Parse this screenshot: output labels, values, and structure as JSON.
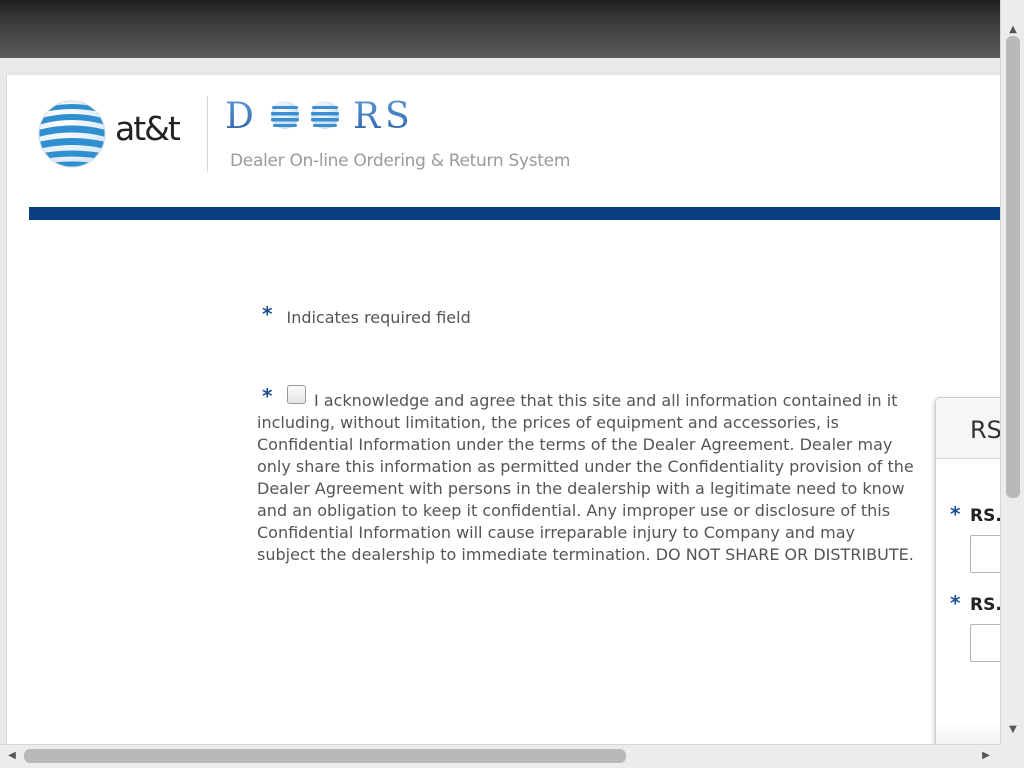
{
  "header": {
    "brand_wordmark": "at&t",
    "app_logo_text": "DOORS",
    "app_subtitle": "Dealer On-line Ordering & Return System"
  },
  "form": {
    "required_marker": "*",
    "required_note": "Indicates required field",
    "acknowledgement": {
      "checked": false,
      "text": "I acknowledge and agree that this site and all information contained in it including, without limitation, the prices of equipment and accessories, is Confidential Information under the terms of the Dealer Agreement. Dealer may only share this information as permitted under the Confidentiality provision of the Dealer Agreement with persons in the dealership with a legitimate need to know and an obligation to keep it confidential. Any improper use or disclosure of this Confidential Information will cause irreparable injury to Company and may subject the dealership to immediate termination. DO NOT SHARE OR DISTRIBUTE."
    }
  },
  "side_panel": {
    "title": "RS",
    "fields": [
      {
        "label": "RS.",
        "value": ""
      },
      {
        "label": "RS.",
        "value": ""
      }
    ]
  },
  "colors": {
    "accent_blue": "#0b3f82",
    "asterisk_blue": "#1b4f95",
    "globe_blue": "#2f8fd0"
  },
  "icons": {
    "brand_logo": "att-globe-icon",
    "scroll_up": "arrow-up-icon",
    "scroll_down": "arrow-down-icon",
    "scroll_left": "arrow-left-icon",
    "scroll_right": "arrow-right-icon"
  }
}
